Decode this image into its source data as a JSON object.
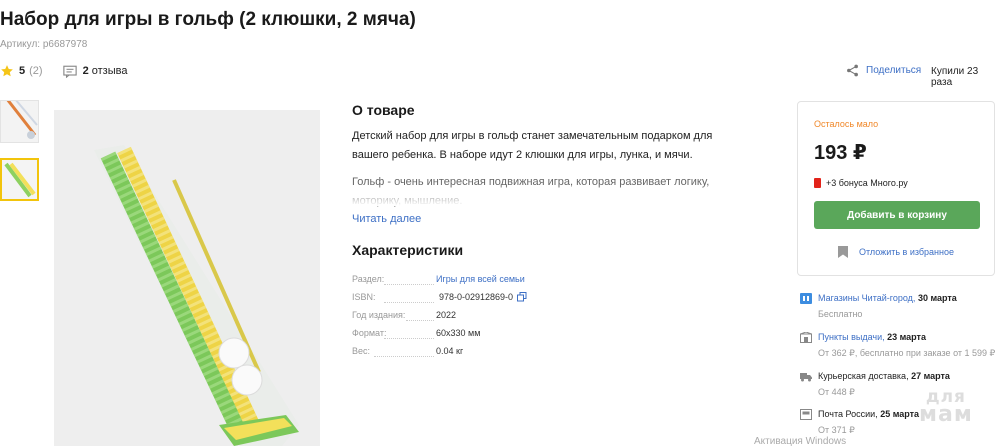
{
  "product": {
    "title": "Набор для игры в гольф (2 клюшки, 2 мяча)",
    "article": "Артикул: р6687978",
    "rating": "5",
    "rating_count": "(2)",
    "reviews_count": "2",
    "reviews_label": "отзыва"
  },
  "header_actions": {
    "share": "Поделиться",
    "bought": "Купили 23 раза"
  },
  "about": {
    "title": "О товаре",
    "description_1": "Детский набор для игры в гольф станет замечательным подарком для вашего ребенка. В наборе идут 2 клюшки для игры, лунка, и мячи.",
    "description_2": "Гольф - очень интересная подвижная игра, которая развивает логику, моторику, мышление.",
    "read_more": "Читать далее"
  },
  "characteristics": {
    "title": "Характеристики",
    "rows": [
      {
        "key": "Раздел:",
        "value": "Игры для всей семьи"
      },
      {
        "key": "ISBN:",
        "value": "978-0-02912869-0"
      },
      {
        "key": "Год издания:",
        "value": "2022"
      },
      {
        "key": "Формат:",
        "value": "60x330 мм"
      },
      {
        "key": "Вес:",
        "value": "0.04 кг"
      }
    ]
  },
  "buy_card": {
    "stock_status": "Осталось мало",
    "price": "193 ₽",
    "bonus": "+3 бонуса Много.ру",
    "add_to_cart": "Добавить в корзину",
    "favorite": "Отложить в избранное"
  },
  "delivery": [
    {
      "icon": "store-icon",
      "link": "Магазины Читай-город,",
      "date": "30 марта",
      "sub": "Бесплатно"
    },
    {
      "icon": "pickup-point-icon",
      "link": "Пункты выдачи,",
      "date": "23 марта",
      "sub": "От 362 ₽, бесплатно при заказе от 1 599 ₽"
    },
    {
      "icon": "courier-truck-icon",
      "link": "",
      "text": "Курьерская доставка,",
      "date": "27 марта",
      "sub": "От 448 ₽"
    },
    {
      "icon": "post-icon",
      "link": "",
      "text": "Почта России,",
      "date": "25 марта",
      "sub": "От 371 ₽"
    }
  ],
  "overlay": {
    "watermark_top": "для",
    "watermark_bottom": "мам",
    "activation": "Активация Windows"
  },
  "colors": {
    "link": "#3d6fc5",
    "cart_button": "#5aa75a",
    "stock_low": "#f0882a",
    "star": "#f5c518",
    "thumb_selected": "#f2c40c"
  }
}
